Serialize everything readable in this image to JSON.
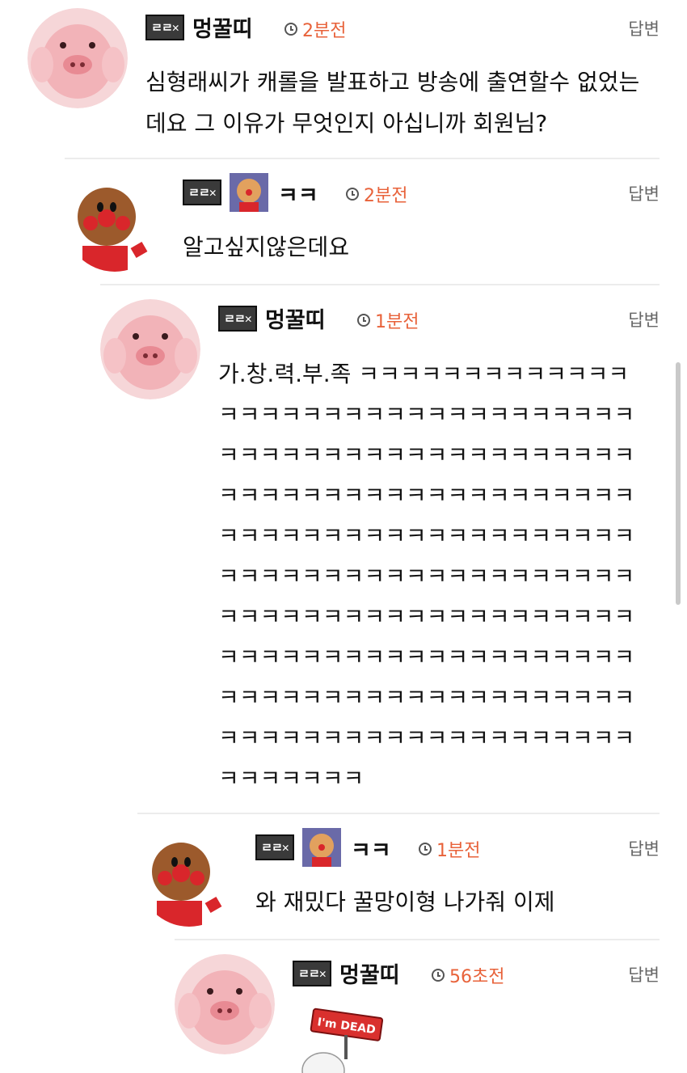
{
  "reply_label": "답변",
  "comments": [
    {
      "user": "멍꿀띠",
      "badge": "ㄹㄹ✕",
      "time": "2분전",
      "text": "심형래씨가 캐롤을 발표하고 방송에 출연할수 없었는데요 그 이유가 무엇인지 아십니까 회원님?",
      "avatar": "pig-avatar"
    },
    {
      "user": "ㅋㅋ",
      "badge": "ㄹㄹ✕",
      "time": "2분전",
      "text": "알고싶지않은데요",
      "avatar": "anpanman-avatar"
    },
    {
      "user": "멍꿀띠",
      "badge": "ㄹㄹ✕",
      "time": "1분전",
      "text": "가.창.력.부.족 ㅋㅋㅋㅋㅋㅋㅋㅋㅋㅋㅋㅋㅋㅋㅋㅋㅋㅋㅋㅋㅋㅋㅋㅋㅋㅋㅋㅋㅋㅋㅋㅋㅋㅋㅋㅋㅋㅋㅋㅋㅋㅋㅋㅋㅋㅋㅋㅋㅋㅋㅋㅋㅋㅋㅋㅋㅋㅋㅋㅋㅋㅋㅋㅋㅋㅋㅋㅋㅋㅋㅋㅋㅋㅋㅋㅋㅋㅋㅋㅋㅋㅋㅋㅋㅋㅋㅋㅋㅋㅋㅋㅋㅋㅋㅋㅋㅋㅋㅋㅋㅋㅋㅋㅋㅋㅋㅋㅋㅋㅋㅋㅋㅋㅋㅋㅋㅋㅋㅋㅋㅋㅋㅋㅋㅋㅋㅋㅋㅋㅋㅋㅋㅋㅋㅋㅋㅋㅋㅋㅋㅋㅋㅋㅋㅋㅋㅋㅋㅋㅋㅋㅋㅋㅋㅋㅋㅋㅋㅋㅋㅋㅋㅋㅋㅋㅋㅋㅋㅋㅋㅋㅋㅋㅋㅋㅋㅋㅋㅋㅋㅋㅋㅋㅋㅋㅋㅋㅋㅋㅋㅋㅋㅋㅋㅋㅋㅋㅋㅋㅋ",
      "avatar": "pig-avatar"
    },
    {
      "user": "ㅋㅋ",
      "badge": "ㄹㄹ✕",
      "time": "1분전",
      "text": "와 재밌다 꿀망이형 나가줘 이제",
      "avatar": "anpanman-avatar"
    },
    {
      "user": "멍꿀띠",
      "badge": "ㄹㄹ✕",
      "time": "56초전",
      "text": "",
      "avatar": "pig-avatar",
      "sticker_text": "I'm DEAD"
    }
  ]
}
